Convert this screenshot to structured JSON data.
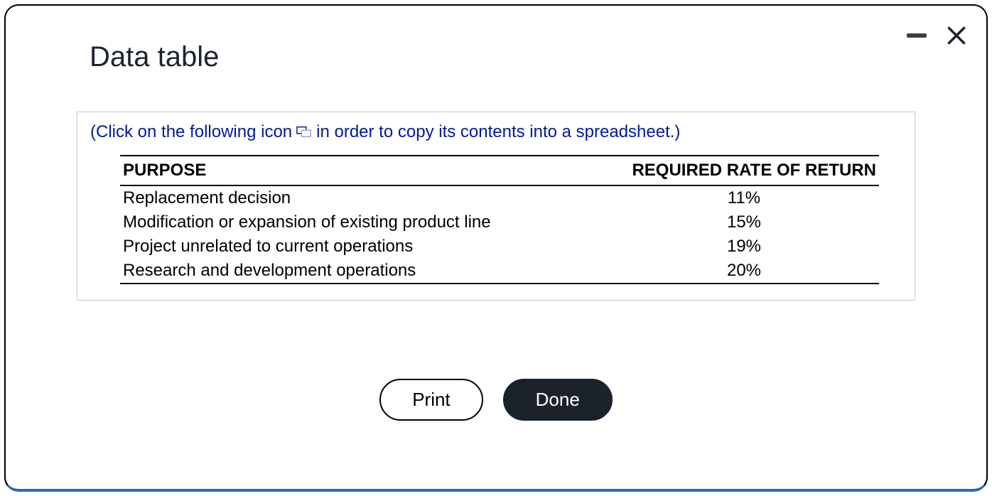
{
  "dialog": {
    "title": "Data table",
    "instruction_before": "(Click on the following icon",
    "instruction_after": "in order to copy its contents into a spreadsheet.)"
  },
  "table": {
    "headers": {
      "purpose": "PURPOSE",
      "rate": "REQUIRED RATE OF RETURN"
    },
    "rows": [
      {
        "purpose": "Replacement decision",
        "rate": "11%"
      },
      {
        "purpose": "Modification or expansion of existing product line",
        "rate": "15%"
      },
      {
        "purpose": "Project unrelated to current operations",
        "rate": "19%"
      },
      {
        "purpose": "Research and development operations",
        "rate": "20%"
      }
    ]
  },
  "buttons": {
    "print": "Print",
    "done": "Done"
  }
}
